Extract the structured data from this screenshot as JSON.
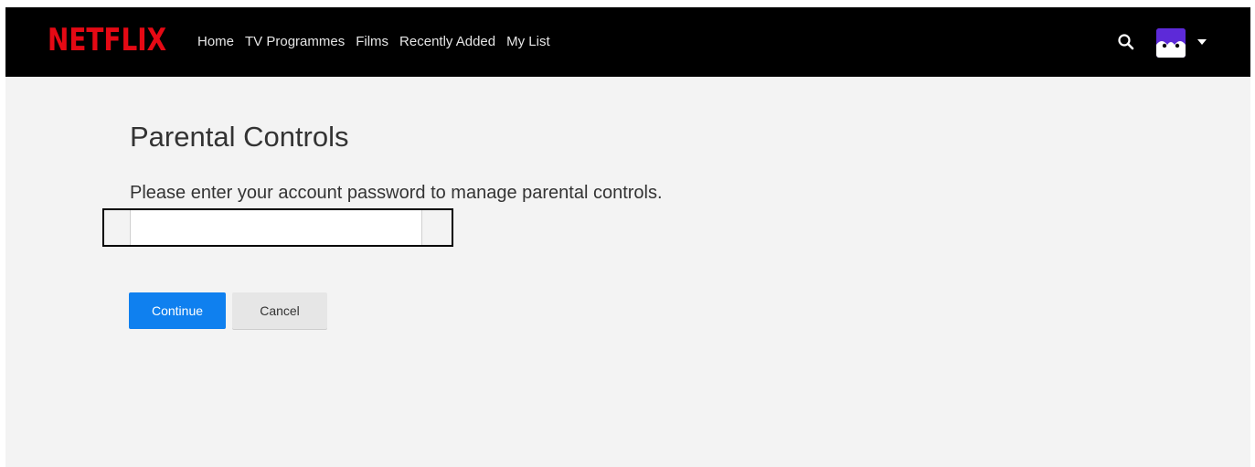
{
  "header": {
    "logo_text": "NETFLIX",
    "nav": [
      {
        "label": "Home"
      },
      {
        "label": "TV Programmes"
      },
      {
        "label": "Films"
      },
      {
        "label": "Recently Added"
      },
      {
        "label": "My List"
      }
    ],
    "icons": {
      "search": "search-icon",
      "avatar": "profile-avatar",
      "caret": "caret-down-icon"
    }
  },
  "main": {
    "title": "Parental Controls",
    "prompt": "Please enter your account password to manage parental controls.",
    "password_value": "",
    "continue_label": "Continue",
    "cancel_label": "Cancel"
  },
  "colors": {
    "brand_red": "#e50914",
    "primary_button": "#0f80ef",
    "avatar_bg": "#5d2ad8",
    "page_bg": "#f3f3f3",
    "navbar_bg": "#000000"
  }
}
